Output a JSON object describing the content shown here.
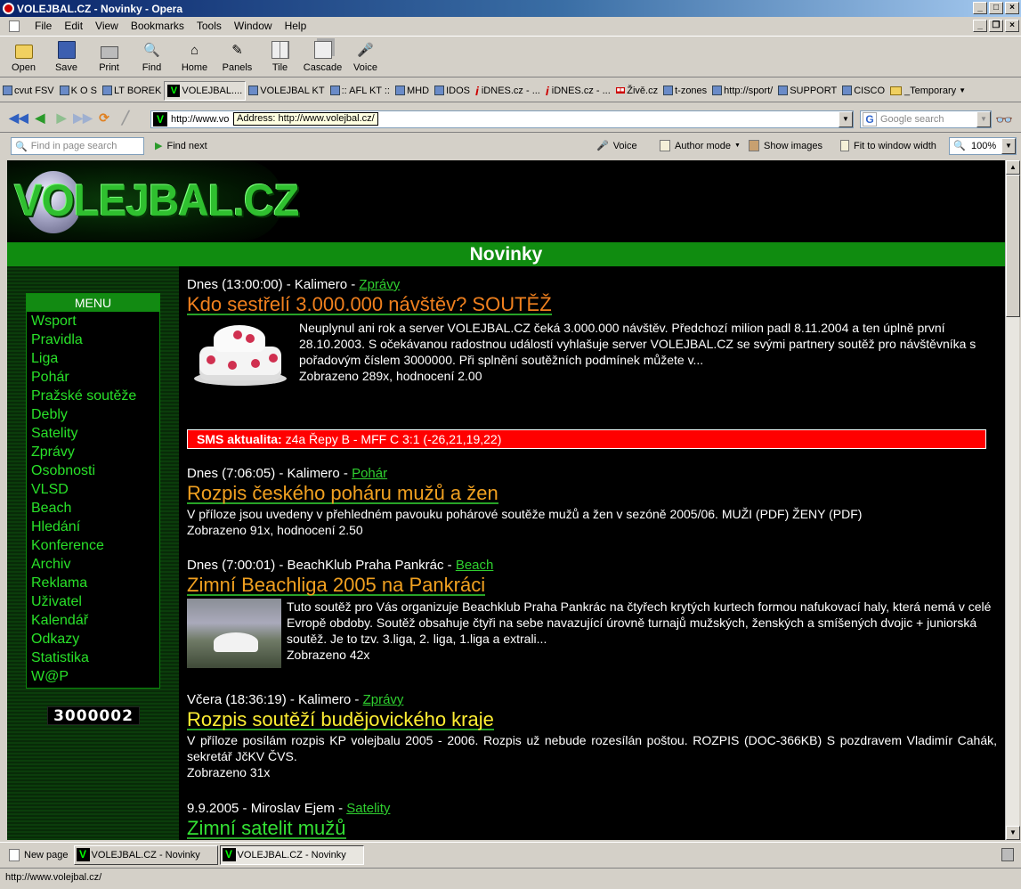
{
  "window": {
    "title": "VOLEJBAL.CZ - Novinky - Opera"
  },
  "menubar": [
    "File",
    "Edit",
    "View",
    "Bookmarks",
    "Tools",
    "Window",
    "Help"
  ],
  "toolbar": {
    "buttons": [
      {
        "label": "Open",
        "icon": "folder-open-icon"
      },
      {
        "label": "Save",
        "icon": "floppy-icon"
      },
      {
        "label": "Print",
        "icon": "printer-icon"
      },
      {
        "label": "Find",
        "icon": "magnifier-icon"
      },
      {
        "label": "Home",
        "icon": "house-icon"
      },
      {
        "label": "Panels",
        "icon": "panels-icon"
      },
      {
        "label": "Tile",
        "icon": "tile-icon"
      },
      {
        "label": "Cascade",
        "icon": "cascade-icon"
      },
      {
        "label": "Voice",
        "icon": "microphone-icon"
      }
    ]
  },
  "bookmarks": [
    "cvut FSV",
    "K O S",
    "LT BOREK",
    "VOLEJBAL....",
    "VOLEJBAL KT",
    ":: AFL KT ::",
    "MHD",
    "IDOS",
    "iDNES.cz - ...",
    "iDNES.cz - ...",
    "Živě.cz",
    "t-zones",
    "http://sport/",
    "SUPPORT",
    "CISCO",
    "_Temporary"
  ],
  "address": {
    "value": "http://www.vo",
    "tooltip": "Address: http://www.volejbal.cz/"
  },
  "search": {
    "placeholder": "Google search"
  },
  "viewbar": {
    "find_placeholder": "Find in page search",
    "find_next": "Find next",
    "voice": "Voice",
    "author_mode": "Author mode",
    "show_images": "Show images",
    "fit_width": "Fit to window width",
    "zoom": "100%"
  },
  "page": {
    "logo": "VOLEJBAL.CZ",
    "header": "Novinky",
    "menu_title": "MENU",
    "menu": [
      "Wsport",
      "Pravidla",
      "Liga",
      "Pohár",
      "Pražské soutěže",
      "Debly",
      "Satelity",
      "Zprávy",
      "Osobnosti",
      "VLSD",
      "Beach",
      "Hledání",
      "Konference",
      "Archiv",
      "Reklama",
      "Uživatel",
      "Kalendář",
      "Odkazy",
      "Statistika",
      "W@P"
    ],
    "counter": "3000002",
    "articles": [
      {
        "meta": "Dnes (13:00:00) - Kalimero - ",
        "category": "Zprávy",
        "title": "Kdo sestřelí 3.000.000 návštěv? SOUTĚŽ",
        "body": "Neuplynul ani rok a server VOLEJBAL.CZ čeká 3.000.000 návštěv. Předchozí milion padl 8.11.2004 a ten úplně první 28.10.2003. S očekávanou radostnou událostí vyhlašuje server VOLEJBAL.CZ se svými partnery soutěž pro návštěvníka s pořadovým číslem 3000000. Při splnění soutěžních podmínek můžete v...",
        "stats": "Zobrazeno 289x, hodnocení 2.00"
      },
      {
        "meta": "Dnes (7:06:05) - Kalimero - ",
        "category": "Pohár",
        "title": "Rozpis českého poháru mužů a žen",
        "body": "V příloze jsou uvedeny v přehledném pavouku pohárové soutěže mužů a žen v sezóně 2005/06. MUŽI (PDF) ŽENY (PDF)",
        "stats": "Zobrazeno 91x, hodnocení 2.50"
      },
      {
        "meta": "Dnes (7:00:01) - BeachKlub Praha Pankrác - ",
        "category": "Beach",
        "title": "Zimní Beachliga 2005 na Pankráci",
        "body": "Tuto soutěž pro Vás organizuje Beachklub Praha Pankrác na čtyřech krytých kurtech formou nafukovací haly, která nemá v celé Evropě obdoby. Soutěž obsahuje čtyři na sebe navazující úrovně turnajů mužských, ženských a smíšených dvojic + juniorská soutěž. Je to tzv. 3.liga, 2. liga, 1.liga a extrali...",
        "stats": "Zobrazeno 42x"
      },
      {
        "meta": "Včera (18:36:19) - Kalimero - ",
        "category": "Zprávy",
        "title": "Rozpis soutěží budějovického kraje",
        "body": "V příloze posílám rozpis KP volejbalu 2005 - 2006. Rozpis už nebude rozesílán poštou. ROZPIS (DOC-366KB) S pozdravem Vladimír Cahák, sekretář JčKV ČVS.",
        "stats": "Zobrazeno 31x"
      },
      {
        "meta": "9.9.2005 - Miroslav Ejem - ",
        "category": "Satelity",
        "title": "Zimní satelit mužů"
      }
    ],
    "sms": {
      "label": "SMS aktualita:",
      "text": " z4a Řepy B - MFF C 3:1 (-26,21,19,22)"
    }
  },
  "tabs": {
    "new_page": "New page",
    "items": [
      "VOLEJBAL.CZ - Novinky",
      "VOLEJBAL.CZ - Novinky"
    ]
  },
  "status": "http://www.volejbal.cz/"
}
